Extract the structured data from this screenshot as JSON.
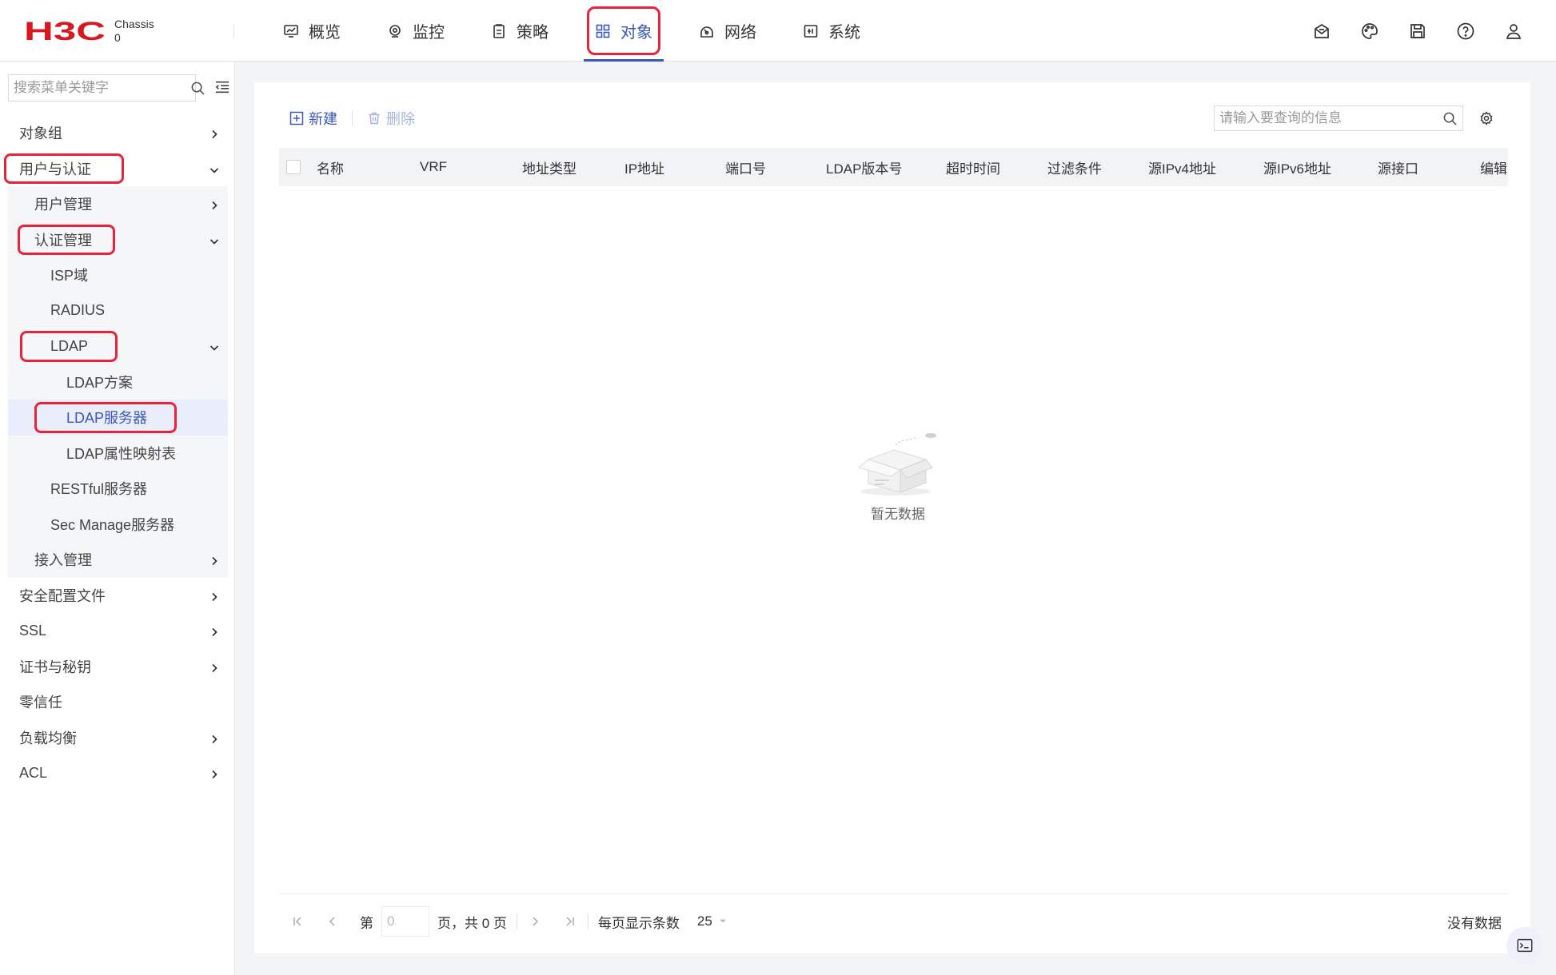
{
  "header": {
    "brand": "H3C",
    "chassis_label": "Chassis",
    "chassis_value": "0",
    "nav": [
      {
        "label": "概览",
        "icon": "dashboard-icon"
      },
      {
        "label": "监控",
        "icon": "monitor-icon"
      },
      {
        "label": "策略",
        "icon": "policy-icon"
      },
      {
        "label": "对象",
        "icon": "object-grid-icon",
        "active": true
      },
      {
        "label": "网络",
        "icon": "network-icon"
      },
      {
        "label": "系统",
        "icon": "system-icon"
      }
    ],
    "tools": [
      "message-icon",
      "theme-palette-icon",
      "save-icon",
      "help-icon",
      "user-icon"
    ]
  },
  "sidebar": {
    "search_placeholder": "搜索菜单关键字",
    "menu": [
      {
        "label": "对象组",
        "level": 1,
        "chevron": "right"
      },
      {
        "label": "用户与认证",
        "level": 1,
        "chevron": "down",
        "highlighted": true
      },
      {
        "label": "用户管理",
        "level": 2,
        "chevron": "right"
      },
      {
        "label": "认证管理",
        "level": 2,
        "chevron": "down",
        "highlighted": true
      },
      {
        "label": "ISP域",
        "level": 3
      },
      {
        "label": "RADIUS",
        "level": 3
      },
      {
        "label": "LDAP",
        "level": 3,
        "chevron": "down",
        "highlighted": true
      },
      {
        "label": "LDAP方案",
        "level": 4
      },
      {
        "label": "LDAP服务器",
        "level": 4,
        "selected": true,
        "highlighted": true
      },
      {
        "label": "LDAP属性映射表",
        "level": 4
      },
      {
        "label": "RESTful服务器",
        "level": 3
      },
      {
        "label": "Sec Manage服务器",
        "level": 3
      },
      {
        "label": "接入管理",
        "level": 2,
        "chevron": "right"
      },
      {
        "label": "安全配置文件",
        "level": 1,
        "chevron": "right"
      },
      {
        "label": "SSL",
        "level": 1,
        "chevron": "right"
      },
      {
        "label": "证书与秘钥",
        "level": 1,
        "chevron": "right"
      },
      {
        "label": "零信任",
        "level": 1
      },
      {
        "label": "负载均衡",
        "level": 1,
        "chevron": "right"
      },
      {
        "label": "ACL",
        "level": 1,
        "chevron": "right"
      }
    ]
  },
  "toolbar": {
    "new_label": "新建",
    "delete_label": "删除",
    "search_placeholder": "请输入要查询的信息"
  },
  "table": {
    "columns": [
      "名称",
      "VRF",
      "地址类型",
      "IP地址",
      "端口号",
      "LDAP版本号",
      "超时时间",
      "过滤条件",
      "源IPv4地址",
      "源IPv6地址",
      "源接口",
      "编辑"
    ],
    "rows": [],
    "empty_text": "暂无数据"
  },
  "pager": {
    "page_prefix": "第",
    "page_placeholder": "0",
    "page_suffix": "页，共 0 页",
    "page_size_label": "每页显示条数",
    "page_size": "25",
    "status": "没有数据"
  },
  "colors": {
    "accent": "#3c58b7",
    "highlight": "#e8233b",
    "brand_red": "#d7191f"
  }
}
